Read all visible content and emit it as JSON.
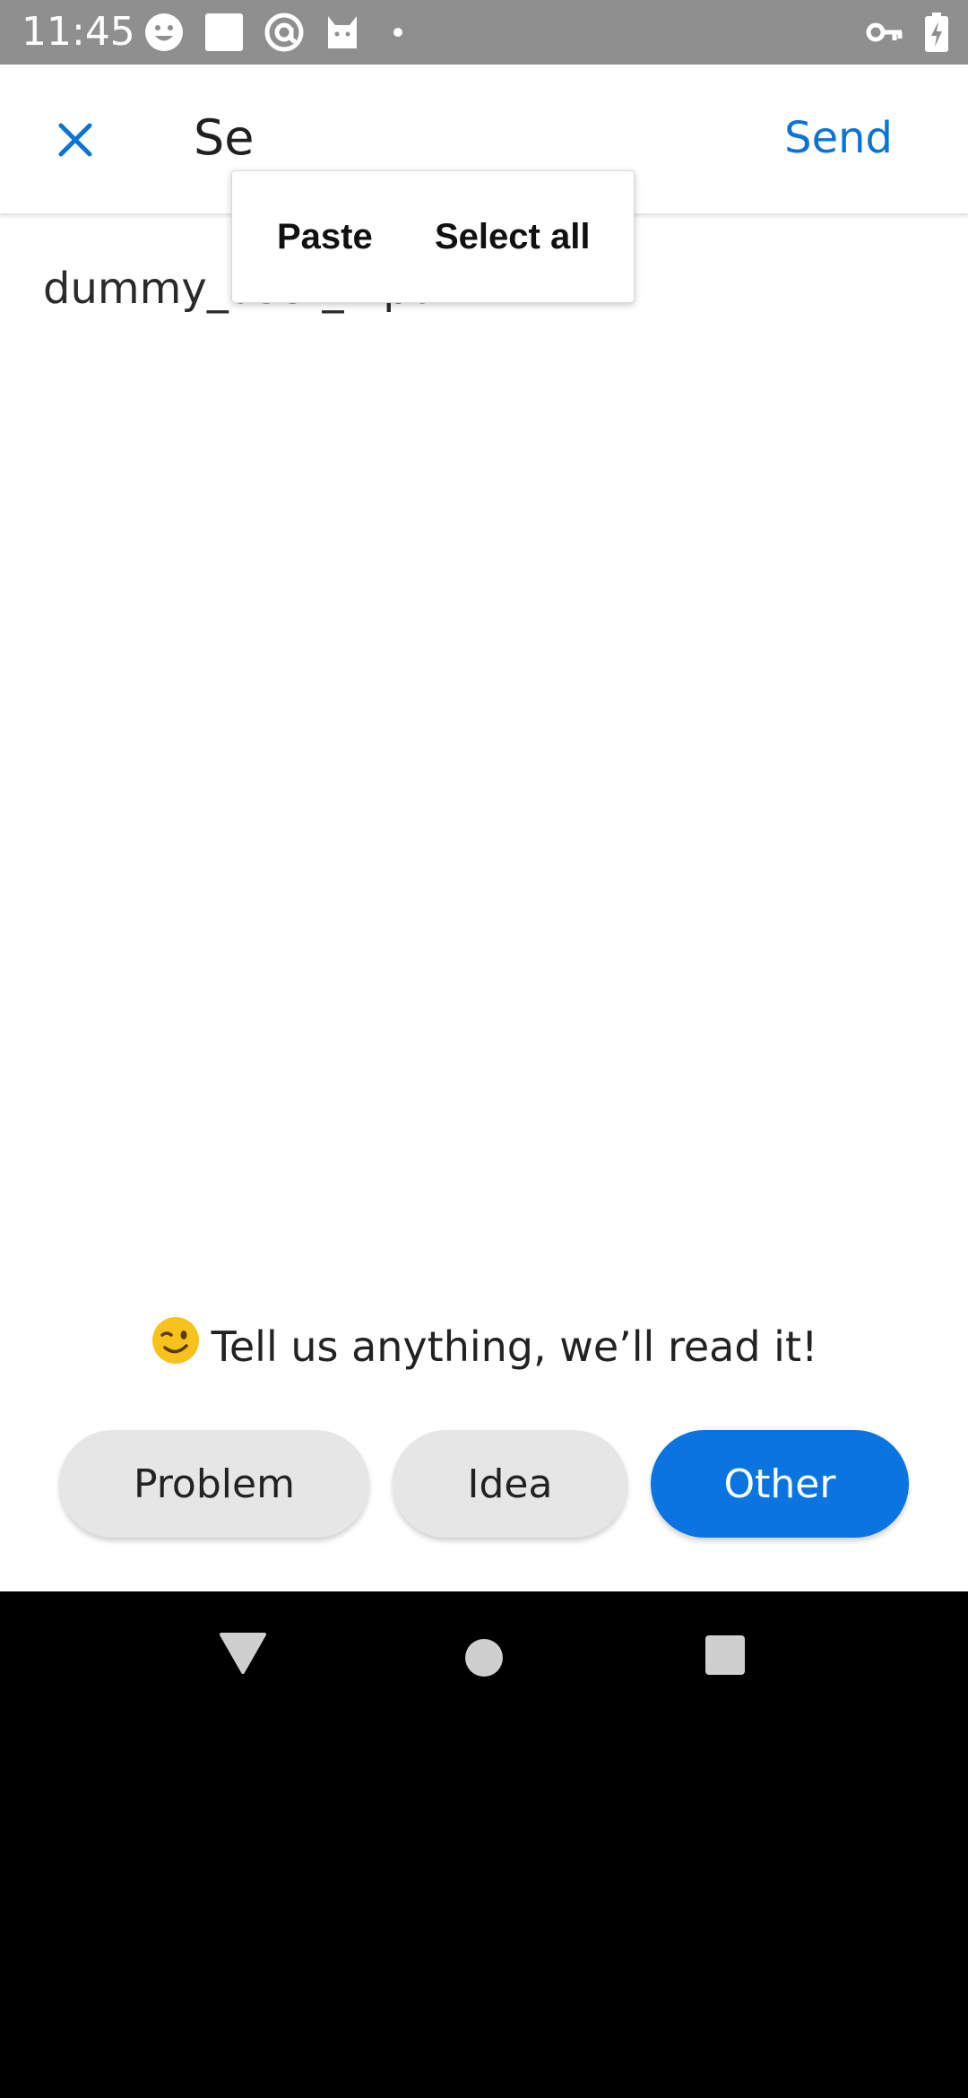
{
  "status_bar": {
    "time": "11:45",
    "left_icons": [
      "smiley-icon",
      "square-icon",
      "at-sign-icon",
      "cat-icon",
      "dot-icon"
    ],
    "right_icons": [
      "key-icon",
      "battery-charging-icon"
    ]
  },
  "toolbar": {
    "title": "Se",
    "send_label": "Send",
    "accent_color": "#0a74d6"
  },
  "context_menu": {
    "items": [
      {
        "label": "Paste"
      },
      {
        "label": "Select all"
      }
    ]
  },
  "message": {
    "text": "dummy_user_input"
  },
  "prompt": {
    "text": "Tell us anything, we’ll read it!",
    "emoji": "winking-face-icon"
  },
  "categories": {
    "items": [
      {
        "label": "Problem",
        "selected": false
      },
      {
        "label": "Idea",
        "selected": false
      },
      {
        "label": "Other",
        "selected": true
      }
    ],
    "selected_color": "#0a74e0",
    "unselected_color": "#e6e6e7"
  },
  "nav_bar": {
    "icons": [
      "back-triangle-icon",
      "home-circle-icon",
      "recents-square-icon"
    ]
  }
}
